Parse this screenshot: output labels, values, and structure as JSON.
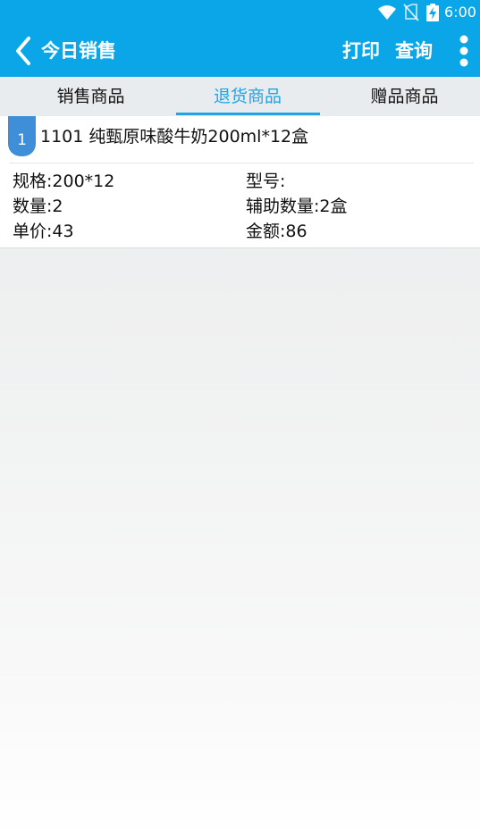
{
  "status_bar": {
    "time": "6:00",
    "icons": [
      "wifi-icon",
      "no-sim-icon",
      "battery-charging-icon"
    ]
  },
  "app_bar": {
    "back_icon": "chevron-left-icon",
    "title": "今日销售",
    "actions": {
      "print": "打印",
      "query": "查询"
    },
    "overflow_icon": "more-vert-icon",
    "color": "#0aa6e8"
  },
  "tabs": [
    {
      "label": "销售商品",
      "selected": false
    },
    {
      "label": "退货商品",
      "selected": true
    },
    {
      "label": "赠品商品",
      "selected": false
    }
  ],
  "accent_color": "#22a3e6",
  "items": [
    {
      "index": "1",
      "title": "1101 纯甄原味酸牛奶200ml*12盒",
      "spec": "规格:200*12",
      "model": "型号:",
      "quantity": "数量:2",
      "aux_quantity": "辅助数量:2盒",
      "unit_price": "单价:43",
      "amount": "金额:86"
    }
  ]
}
